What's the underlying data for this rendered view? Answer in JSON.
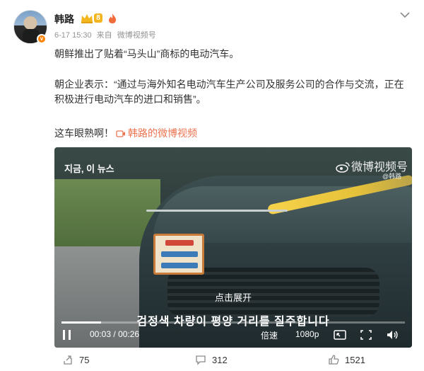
{
  "post": {
    "author": {
      "name": "韩路",
      "level": "8",
      "avatar_badge": "v"
    },
    "meta": {
      "date": "6-17 15:30",
      "source_prefix": "来自",
      "source": "微博视频号"
    },
    "text": {
      "line1": "朝鲜推出了贴着“马头山”商标的电动汽车。",
      "line2": "朝企业表示：“通过与海外知名电动汽车生产公司及服务公司的合作与交流，正在",
      "line3": "积极进行电动汽车的进口和销售”。",
      "line4": "这车眼熟啊！"
    },
    "video_link": {
      "label": "韩路的微博视频"
    },
    "colors": {
      "link": "#eb7350",
      "meta": "#939393",
      "badge": "#ff8200"
    }
  },
  "video": {
    "watermark_left": "지금, 이 뉴스",
    "watermark_right": "微博视频号",
    "watermark_sub": "@韩路",
    "expand_label": "点击展开",
    "subtitle": "검정색 차량이 평양 거리를 질주합니다",
    "progress": 0.115,
    "current_time": "00:03",
    "separator": "/",
    "duration": "00:26",
    "speed_label": "倍速",
    "quality_label": "1080p",
    "icons": [
      "pause-icon",
      "picture-in-picture-icon",
      "fullscreen-icon",
      "volume-icon"
    ]
  },
  "actions": {
    "repost_count": "75",
    "comment_count": "312",
    "like_count": "1521"
  }
}
